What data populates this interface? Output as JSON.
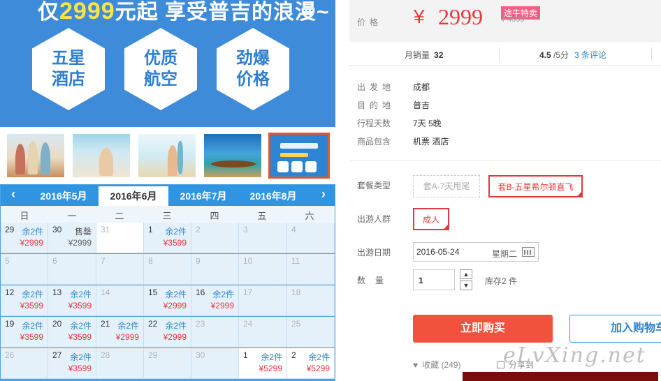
{
  "banner": {
    "headline_pre": "仅",
    "headline_price": "2999",
    "headline_post": "元起 享受普吉的浪漫~",
    "features": [
      "五星酒店",
      "优质航空",
      "劲爆价格"
    ],
    "feature_color": "#2e7fd0"
  },
  "thumbnails": [
    {
      "name": "beach-girls-photo"
    },
    {
      "name": "beach-couple-photo"
    },
    {
      "name": "surf-girl-photo"
    },
    {
      "name": "longtail-boat-photo"
    },
    {
      "name": "promo-poster-photo",
      "selected": true
    }
  ],
  "calendar": {
    "months": [
      "2016年5月",
      "2016年6月",
      "2016年7月",
      "2016年8月"
    ],
    "active_month": "2016年6月",
    "prev_icon": "chevron-left-icon",
    "next_icon": "chevron-right-icon",
    "weekdays": [
      "日",
      "一",
      "二",
      "三",
      "四",
      "五",
      "六"
    ],
    "weeks": [
      [
        {
          "day": "29",
          "stock": "余2件",
          "price": "¥2999"
        },
        {
          "day": "30",
          "stock": "售罄",
          "price": "¥2999",
          "sold": true
        },
        {
          "day": "31",
          "dim": true,
          "white": true
        },
        {
          "day": "1",
          "stock": "余2件",
          "price": "¥3599"
        },
        {
          "day": "2",
          "dim": true
        },
        {
          "day": "3",
          "dim": true
        },
        {
          "day": "4",
          "dim": true
        }
      ],
      [
        {
          "day": "5",
          "dim": true
        },
        {
          "day": "6",
          "dim": true
        },
        {
          "day": "7",
          "dim": true
        },
        {
          "day": "8",
          "dim": true
        },
        {
          "day": "9",
          "dim": true
        },
        {
          "day": "10",
          "dim": true
        },
        {
          "day": "11",
          "dim": true
        }
      ],
      [
        {
          "day": "12",
          "stock": "余2件",
          "price": "¥3599"
        },
        {
          "day": "13",
          "stock": "余2件",
          "price": "¥3599"
        },
        {
          "day": "14",
          "dim": true
        },
        {
          "day": "15",
          "stock": "余2件",
          "price": "¥2999"
        },
        {
          "day": "16",
          "stock": "余2件",
          "price": "¥2999"
        },
        {
          "day": "17",
          "dim": true
        },
        {
          "day": "18",
          "dim": true
        }
      ],
      [
        {
          "day": "19",
          "stock": "余2件",
          "price": "¥3599"
        },
        {
          "day": "20",
          "stock": "余2件",
          "price": "¥3599"
        },
        {
          "day": "21",
          "stock": "余2件",
          "price": "¥2999"
        },
        {
          "day": "22",
          "stock": "余2件",
          "price": "¥2999"
        },
        {
          "day": "23",
          "dim": true
        },
        {
          "day": "24",
          "dim": true
        },
        {
          "day": "25",
          "dim": true
        }
      ],
      [
        {
          "day": "26",
          "dim": true
        },
        {
          "day": "27",
          "stock": "余2件",
          "price": "¥3599"
        },
        {
          "day": "28",
          "dim": true
        },
        {
          "day": "29",
          "dim": true
        },
        {
          "day": "30",
          "dim": true
        },
        {
          "day": "1",
          "stock": "余2件",
          "price": "¥5299",
          "white": true
        },
        {
          "day": "2",
          "stock": "余2件",
          "price": "¥5299",
          "white": true
        }
      ]
    ]
  },
  "price": {
    "label": "价格",
    "currency": "¥",
    "amount": "2999",
    "badge": "途牛特卖",
    "original": "¥ 4999",
    "accent": "#e4393c"
  },
  "stats": {
    "sales_label": "月销量",
    "sales_value": "32",
    "rating": "4.5",
    "rating_scale": "/5分",
    "comments": "3 条评论"
  },
  "info": [
    {
      "key": "出发地",
      "value": "成都",
      "spaced": true
    },
    {
      "key": "目的地",
      "value": "普吉",
      "spaced": true
    },
    {
      "key": "行程天数",
      "value": "7天 5晚",
      "spaced": false
    },
    {
      "key": "商品包含",
      "value": "机票  酒店",
      "spaced": false
    }
  ],
  "options": {
    "package_label": "套餐类型",
    "package_a": "套A-7天甩尾",
    "package_b": "套B-五星希尔顿直飞",
    "group_label": "出游人群",
    "group_value": "成人",
    "date_label": "出游日期",
    "date_value": "2016-05-24",
    "date_weekday": "星期二",
    "qty_label": "数量",
    "qty_value": "1",
    "stock_text": "库存2 件"
  },
  "actions": {
    "buy": "立即购买",
    "cart": "加入购物车",
    "fav": "收藏 (249)",
    "share": "分享到"
  },
  "watermark": "eLvXing.net"
}
